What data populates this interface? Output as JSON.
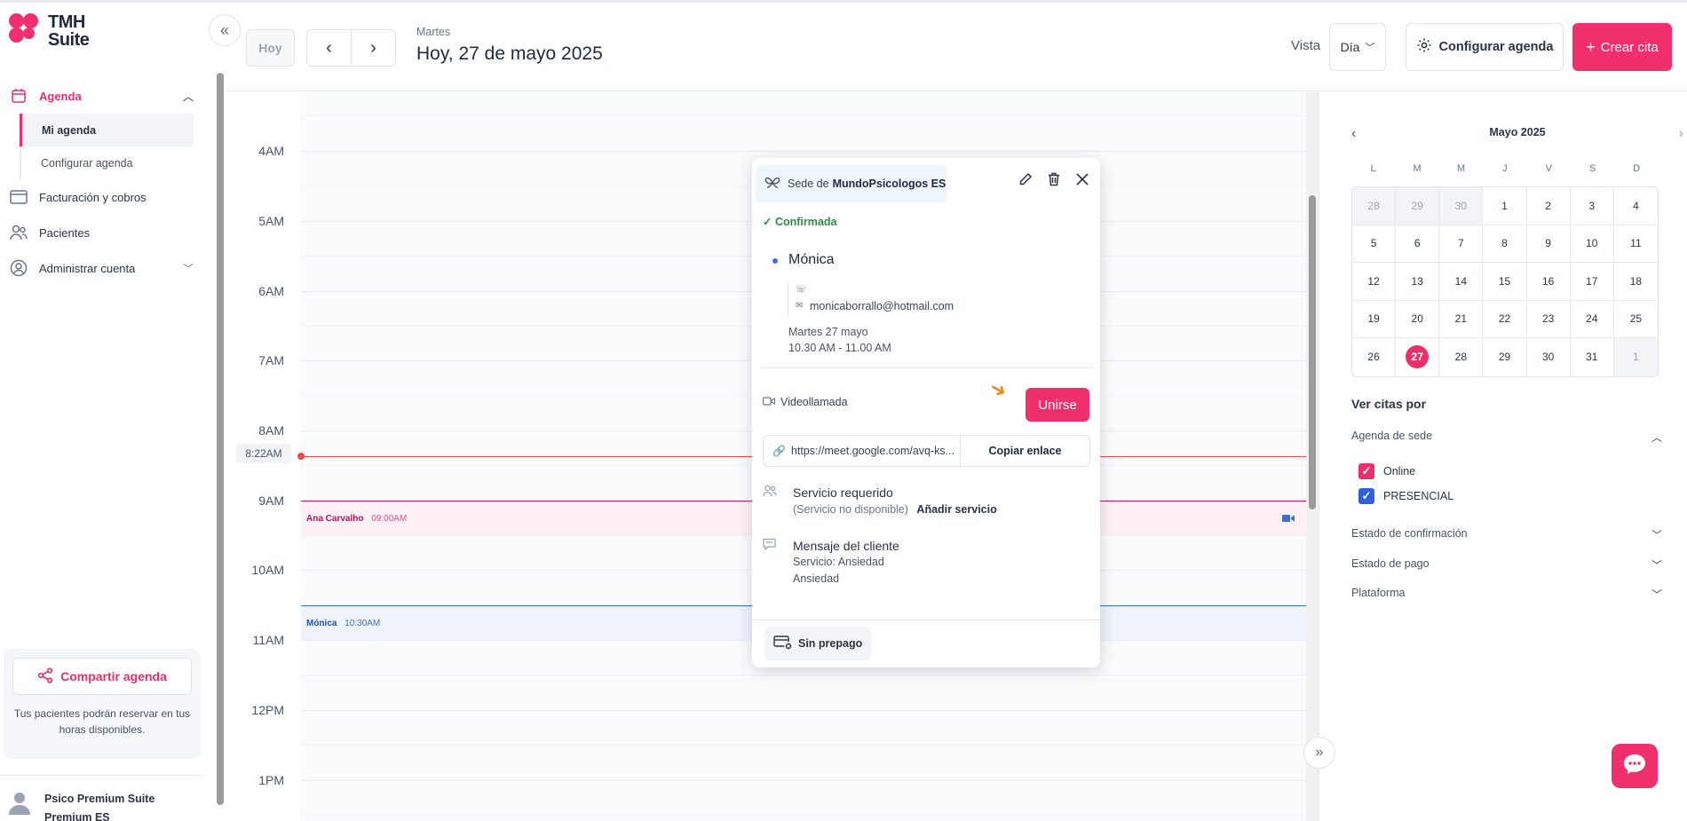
{
  "brand": {
    "line1": "TMH",
    "line2": "Suite"
  },
  "sidebar": {
    "agenda": "Agenda",
    "sub_items": [
      "Mi agenda",
      "Configurar agenda"
    ],
    "billing": "Facturación y cobros",
    "patients": "Pacientes",
    "admin": "Administrar cuenta",
    "share_button": "Compartir agenda",
    "share_text": "Tus pacientes podrán reservar en tus horas disponibles.",
    "user_line1": "Psico Premium Suite",
    "user_line2": "Premium ES"
  },
  "header": {
    "today": "Hoy",
    "day_name": "Martes",
    "title": "Hoy, 27 de mayo 2025",
    "vista_label": "Vista",
    "vista_value": "Día",
    "config_button": "Configurar agenda",
    "create_button": "Crear cita"
  },
  "grid": {
    "hours": [
      "4AM",
      "5AM",
      "6AM",
      "7AM",
      "8AM",
      "9AM",
      "10AM",
      "11AM",
      "12PM",
      "1PM"
    ],
    "now_label": "8:22AM",
    "events": [
      {
        "name": "Ana Carvalho",
        "time": "09:00AM"
      },
      {
        "name": "Mónica",
        "time": "10:30AM"
      }
    ]
  },
  "popup": {
    "sede_prefix": "Sede de",
    "sede_name": "MundoPsicologos ES",
    "status": "Confirmada",
    "client_name": "Mónica",
    "email": "monicaborrallo@hotmail.com",
    "date_line": "Martes 27 mayo",
    "time_line": "10.30 AM - 11.00 AM",
    "video_label": "Videollamada",
    "join_button": "Unirse",
    "link_url": "https://meet.google.com/avq-ks...",
    "copy_link": "Copiar enlace",
    "service_title": "Servicio requerido",
    "service_unavailable": "(Servicio no disponible)",
    "add_service": "Añadir servicio",
    "message_title": "Mensaje del cliente",
    "message_line1": "Servicio: Ansiedad",
    "message_line2": "Ansiedad",
    "prepay": "Sin prepago"
  },
  "mini_calendar": {
    "month": "Mayo 2025",
    "dow": [
      "L",
      "M",
      "M",
      "J",
      "V",
      "S",
      "D"
    ],
    "days": [
      {
        "d": "28",
        "other": true
      },
      {
        "d": "29",
        "other": true
      },
      {
        "d": "30",
        "other": true
      },
      {
        "d": "1"
      },
      {
        "d": "2"
      },
      {
        "d": "3"
      },
      {
        "d": "4"
      },
      {
        "d": "5"
      },
      {
        "d": "6"
      },
      {
        "d": "7"
      },
      {
        "d": "8"
      },
      {
        "d": "9"
      },
      {
        "d": "10"
      },
      {
        "d": "11"
      },
      {
        "d": "12"
      },
      {
        "d": "13"
      },
      {
        "d": "14"
      },
      {
        "d": "15"
      },
      {
        "d": "16"
      },
      {
        "d": "17"
      },
      {
        "d": "18"
      },
      {
        "d": "19"
      },
      {
        "d": "20"
      },
      {
        "d": "21"
      },
      {
        "d": "22"
      },
      {
        "d": "23"
      },
      {
        "d": "24"
      },
      {
        "d": "25"
      },
      {
        "d": "26"
      },
      {
        "d": "27",
        "today": true
      },
      {
        "d": "28"
      },
      {
        "d": "29"
      },
      {
        "d": "30"
      },
      {
        "d": "31"
      },
      {
        "d": "1",
        "other": true
      }
    ]
  },
  "filters": {
    "title": "Ver citas por",
    "agenda_sede": "Agenda de sede",
    "online": "Online",
    "presencial": "PRESENCIAL",
    "confirmation": "Estado de confirmación",
    "payment": "Estado de pago",
    "platform": "Plataforma"
  },
  "colors": {
    "accent": "#f0306c",
    "presencial": "#2f62d8",
    "now_line": "#f04a4a"
  }
}
